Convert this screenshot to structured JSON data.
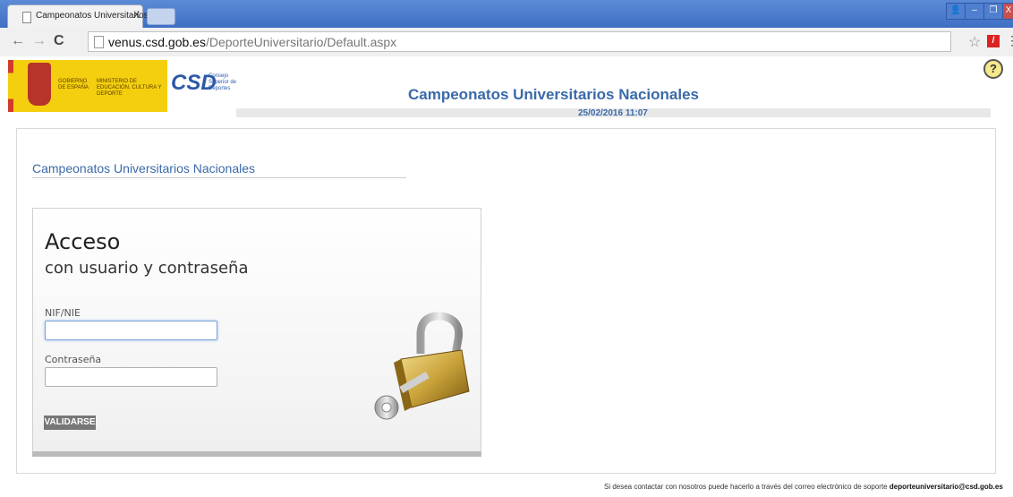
{
  "browser": {
    "tab_title": "Campeonatos Universitarios",
    "tab_close": "X",
    "url_host": "venus.csd.gob.es",
    "url_path": "/DeporteUniversitario/Default.aspx",
    "back_icon": "←",
    "forward_icon": "→",
    "reload_icon": "C",
    "star_icon": "☆",
    "menu_icon": "⋮",
    "win_user": "👤",
    "win_min": "–",
    "win_max": "❐",
    "win_close": "X"
  },
  "header": {
    "gov_text": "GOBIERNO DE ESPAÑA",
    "ministry_text": "MINISTERIO DE EDUCACIÓN, CULTURA Y DEPORTE",
    "csd_mark": "CSD",
    "csd_text": "Consejo Superior de Deportes",
    "site_title": "Campeonatos Universitarios Nacionales",
    "datetime": "25/02/2016 11:07",
    "help_icon": "?"
  },
  "main": {
    "section_title": "Campeonatos Universitarios Nacionales",
    "login": {
      "heading": "Acceso",
      "subheading": "con usuario y contraseña",
      "nif_label": "NIF/NIE",
      "nif_value": "",
      "password_label": "Contraseña",
      "password_value": "",
      "submit_label": "VALIDARSE"
    }
  },
  "footer": {
    "text": "Si desea contactar con nosotros puede hacerlo a través del correo electrónico de soporte ",
    "email": "deporteuniversitario@csd.gob.es"
  }
}
